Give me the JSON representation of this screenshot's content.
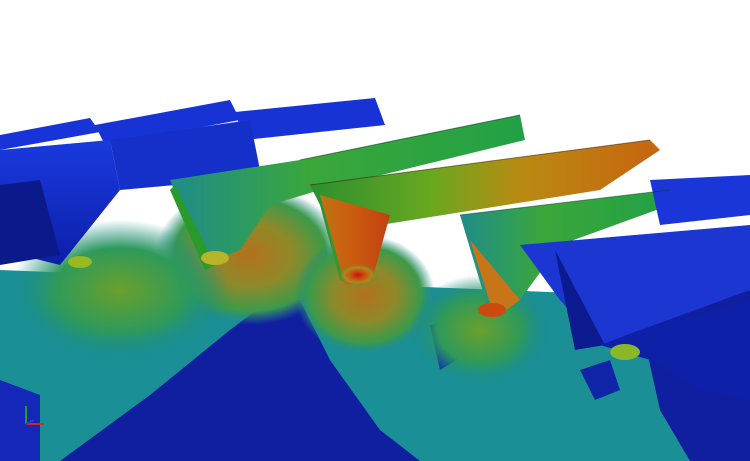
{
  "viewport": {
    "background": "#ffffff"
  },
  "colormap": {
    "deep_blue": "#0a1a8a",
    "blue": "#1530c8",
    "cyan": "#1a8a8a",
    "teal": "#1f9e7a",
    "green": "#2faa3a",
    "yellow_green": "#9ab820",
    "orange": "#c88a10",
    "red": "#d01010"
  },
  "triad": {
    "x_color": "#e02020",
    "y_color": "#20a020",
    "z_color": "#2040e0"
  }
}
